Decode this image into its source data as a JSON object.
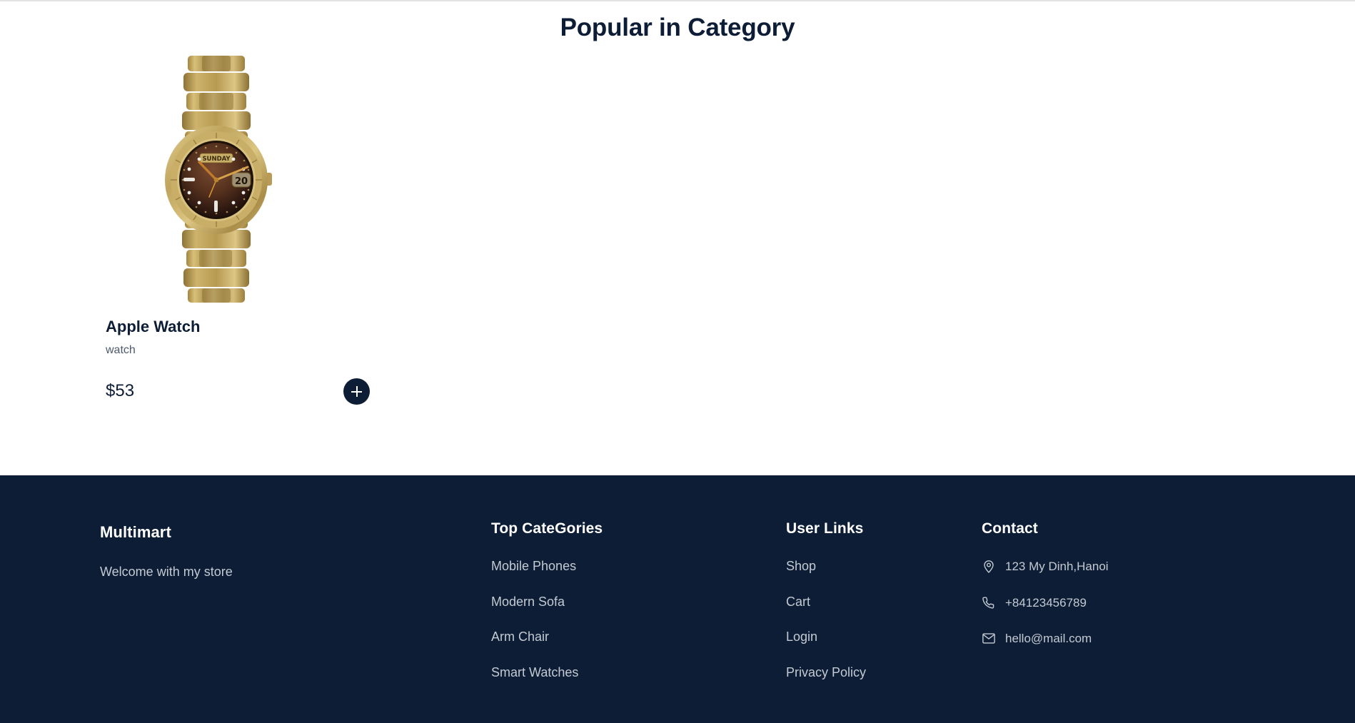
{
  "section": {
    "title": "Popular in Category"
  },
  "products": [
    {
      "name": "Apple Watch",
      "category": "watch",
      "price": "$53",
      "image_alt": "gold-wristwatch",
      "watch_day": "SUNDAY",
      "watch_date": "20",
      "add_label": "+"
    }
  ],
  "footer": {
    "brand": {
      "name": "Multimart",
      "tagline": "Welcome with my store"
    },
    "categories": {
      "heading": "Top CateGories",
      "items": [
        "Mobile Phones",
        "Modern Sofa",
        "Arm Chair",
        "Smart Watches"
      ]
    },
    "user_links": {
      "heading": "User Links",
      "items": [
        "Shop",
        "Cart",
        "Login",
        "Privacy Policy"
      ]
    },
    "contact": {
      "heading": "Contact",
      "items": [
        {
          "icon": "location-pin-icon",
          "text": "123 My Dinh,Hanoi"
        },
        {
          "icon": "phone-icon",
          "text": "+84123456789"
        },
        {
          "icon": "envelope-icon",
          "text": "hello@mail.com"
        }
      ]
    }
  },
  "colors": {
    "page_background": "#ffffff",
    "footer_background": "#0c1d35",
    "heading_text": "#0c1d35",
    "muted_text": "#4d5a6b",
    "footer_text": "#c4cad3",
    "accent_button": "#0c1d35",
    "top_rule": "#e2e2e2"
  }
}
